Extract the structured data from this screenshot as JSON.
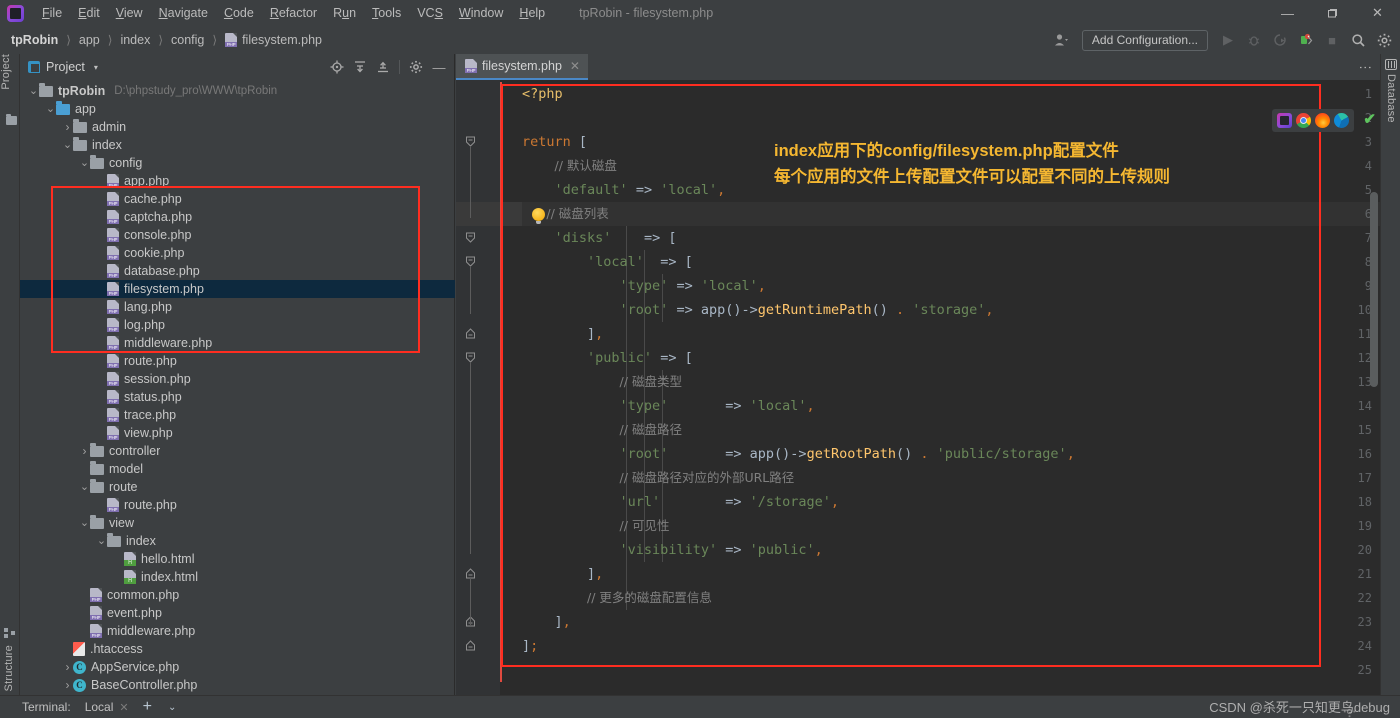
{
  "window": {
    "title": "tpRobin - filesystem.php",
    "app_icon": "phpstorm-logo",
    "controls": {
      "minimize": "—",
      "maximize": "❐",
      "close": "✕"
    }
  },
  "menu": [
    {
      "label": "File"
    },
    {
      "label": "Edit"
    },
    {
      "label": "View"
    },
    {
      "label": "Navigate"
    },
    {
      "label": "Code"
    },
    {
      "label": "Refactor"
    },
    {
      "label": "Run"
    },
    {
      "label": "Tools"
    },
    {
      "label": "VCS"
    },
    {
      "label": "Window"
    },
    {
      "label": "Help"
    }
  ],
  "breadcrumbs": [
    {
      "label": "tpRobin",
      "icon": "none"
    },
    {
      "label": "app",
      "icon": "none"
    },
    {
      "label": "index",
      "icon": "none"
    },
    {
      "label": "config",
      "icon": "none"
    },
    {
      "label": "filesystem.php",
      "icon": "php-file-icon"
    }
  ],
  "toolbar": {
    "avatar_icon": "user-avatar-icon",
    "add_configuration": "Add Configuration...",
    "run_icon": "run-icon",
    "debug_icon": "debug-icon",
    "run_coverage_icon": "run-with-coverage-icon",
    "profile_icon": "profile-icon",
    "stop_icon": "stop-icon",
    "search_icon": "search-everywhere-icon",
    "settings_icon": "settings-gear-icon"
  },
  "left_strip": {
    "label": "Project",
    "icon": "project-folder-icon"
  },
  "right_strip": {
    "label": "Database",
    "icon": "database-icon"
  },
  "bottom_strip": {
    "label": "Structure",
    "icon": "structure-icon"
  },
  "project_panel": {
    "title": "Project",
    "caret": "▾",
    "tools": [
      {
        "name": "locate-icon",
        "glyph": "⊕"
      },
      {
        "name": "expand-all-icon",
        "glyph": "⤓"
      },
      {
        "name": "collapse-all-icon",
        "glyph": "⤒"
      },
      {
        "name": "panel-settings-icon",
        "glyph": "⚙"
      },
      {
        "name": "hide-panel-icon",
        "glyph": "—"
      }
    ],
    "tree": [
      {
        "depth": 0,
        "arrow": "down",
        "icon": "folder",
        "label": "tpRobin",
        "bold": true,
        "path": "D:\\phpstudy_pro\\WWW\\tpRobin"
      },
      {
        "depth": 1,
        "arrow": "down",
        "icon": "folder-blue",
        "label": "app"
      },
      {
        "depth": 2,
        "arrow": "right",
        "icon": "folder",
        "label": "admin"
      },
      {
        "depth": 2,
        "arrow": "down",
        "icon": "folder",
        "label": "index"
      },
      {
        "depth": 3,
        "arrow": "down",
        "icon": "folder",
        "label": "config"
      },
      {
        "depth": 4,
        "arrow": "none",
        "icon": "php",
        "label": "app.php"
      },
      {
        "depth": 4,
        "arrow": "none",
        "icon": "php",
        "label": "cache.php"
      },
      {
        "depth": 4,
        "arrow": "none",
        "icon": "php",
        "label": "captcha.php"
      },
      {
        "depth": 4,
        "arrow": "none",
        "icon": "php",
        "label": "console.php"
      },
      {
        "depth": 4,
        "arrow": "none",
        "icon": "php",
        "label": "cookie.php"
      },
      {
        "depth": 4,
        "arrow": "none",
        "icon": "php",
        "label": "database.php"
      },
      {
        "depth": 4,
        "arrow": "none",
        "icon": "php",
        "label": "filesystem.php",
        "selected": true
      },
      {
        "depth": 4,
        "arrow": "none",
        "icon": "php",
        "label": "lang.php"
      },
      {
        "depth": 4,
        "arrow": "none",
        "icon": "php",
        "label": "log.php"
      },
      {
        "depth": 4,
        "arrow": "none",
        "icon": "php",
        "label": "middleware.php"
      },
      {
        "depth": 4,
        "arrow": "none",
        "icon": "php",
        "label": "route.php"
      },
      {
        "depth": 4,
        "arrow": "none",
        "icon": "php",
        "label": "session.php"
      },
      {
        "depth": 4,
        "arrow": "none",
        "icon": "php",
        "label": "status.php"
      },
      {
        "depth": 4,
        "arrow": "none",
        "icon": "php",
        "label": "trace.php"
      },
      {
        "depth": 4,
        "arrow": "none",
        "icon": "php",
        "label": "view.php"
      },
      {
        "depth": 3,
        "arrow": "right",
        "icon": "folder",
        "label": "controller"
      },
      {
        "depth": 3,
        "arrow": "none",
        "icon": "folder",
        "label": "model"
      },
      {
        "depth": 3,
        "arrow": "down",
        "icon": "folder",
        "label": "route"
      },
      {
        "depth": 4,
        "arrow": "none",
        "icon": "php",
        "label": "route.php"
      },
      {
        "depth": 3,
        "arrow": "down",
        "icon": "folder",
        "label": "view"
      },
      {
        "depth": 4,
        "arrow": "down",
        "icon": "folder",
        "label": "index"
      },
      {
        "depth": 5,
        "arrow": "none",
        "icon": "html",
        "label": "hello.html"
      },
      {
        "depth": 5,
        "arrow": "none",
        "icon": "html",
        "label": "index.html"
      },
      {
        "depth": 3,
        "arrow": "none",
        "icon": "php",
        "label": "common.php"
      },
      {
        "depth": 3,
        "arrow": "none",
        "icon": "php",
        "label": "event.php"
      },
      {
        "depth": 3,
        "arrow": "none",
        "icon": "php",
        "label": "middleware.php"
      },
      {
        "depth": 2,
        "arrow": "none",
        "icon": "htaccess",
        "label": ".htaccess"
      },
      {
        "depth": 2,
        "arrow": "right",
        "icon": "class",
        "label": "AppService.php"
      },
      {
        "depth": 2,
        "arrow": "right",
        "icon": "class",
        "label": "BaseController.php"
      }
    ]
  },
  "editor": {
    "tab": {
      "label": "filesystem.php",
      "icon": "php-file-icon",
      "close": "✕"
    },
    "kebab_icon": "editor-options-icon",
    "inspection_check": "✔",
    "run_icons": [
      {
        "name": "phpstorm-preview-icon"
      },
      {
        "name": "chrome-browser-icon"
      },
      {
        "name": "firefox-browser-icon"
      },
      {
        "name": "edge-browser-icon"
      }
    ],
    "annotation": {
      "line1": "index应用下的config/filesystem.php配置文件",
      "line2": "每个应用的文件上传配置文件可以配置不同的上传规则"
    },
    "highlight_color": "#ff2d20",
    "lines": [
      {
        "n": 1,
        "text": "<?php"
      },
      {
        "n": 2,
        "text": ""
      },
      {
        "n": 3,
        "text": "return ["
      },
      {
        "n": 4,
        "text": "    // 默认磁盘"
      },
      {
        "n": 5,
        "text": "    'default' => 'local',"
      },
      {
        "n": 6,
        "text": "    // 磁盘列表",
        "current": true,
        "bulb": true
      },
      {
        "n": 7,
        "text": "    'disks'    => ["
      },
      {
        "n": 8,
        "text": "        'local'  => ["
      },
      {
        "n": 9,
        "text": "            'type' => 'local',"
      },
      {
        "n": 10,
        "text": "            'root' => app()->getRuntimePath() . 'storage',"
      },
      {
        "n": 11,
        "text": "        ],"
      },
      {
        "n": 12,
        "text": "        'public' => ["
      },
      {
        "n": 13,
        "text": "            // 磁盘类型"
      },
      {
        "n": 14,
        "text": "            'type'       => 'local',"
      },
      {
        "n": 15,
        "text": "            // 磁盘路径"
      },
      {
        "n": 16,
        "text": "            'root'       => app()->getRootPath() . 'public/storage',"
      },
      {
        "n": 17,
        "text": "            // 磁盘路径对应的外部URL路径"
      },
      {
        "n": 18,
        "text": "            'url'        => '/storage',"
      },
      {
        "n": 19,
        "text": "            // 可见性"
      },
      {
        "n": 20,
        "text": "            'visibility' => 'public',"
      },
      {
        "n": 21,
        "text": "        ],"
      },
      {
        "n": 22,
        "text": "        // 更多的磁盘配置信息"
      },
      {
        "n": 23,
        "text": "    ],"
      },
      {
        "n": 24,
        "text": "];"
      },
      {
        "n": 25,
        "text": ""
      }
    ]
  },
  "bottom_bar": {
    "terminal_label": "Terminal:",
    "session": "Local",
    "close_icon": "✕",
    "add_icon": "+",
    "dropdown_icon": "⌄",
    "watermark": "CSDN @杀死一只知更鸟debug"
  }
}
